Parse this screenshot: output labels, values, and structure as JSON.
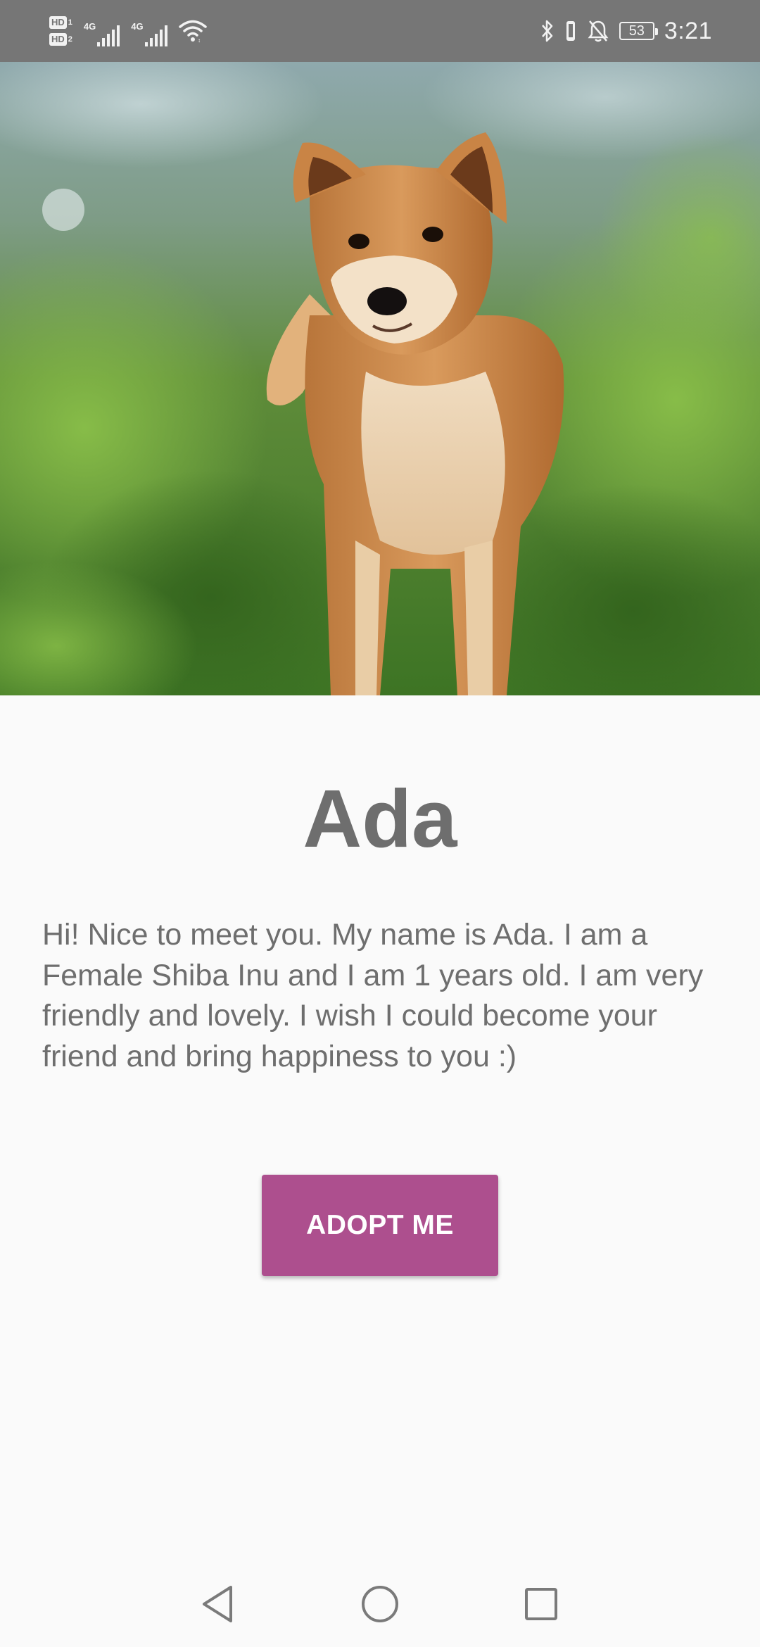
{
  "status_bar": {
    "sim1_label": "HD",
    "sim1_num": "1",
    "sim2_label": "HD",
    "sim2_num": "2",
    "network1": "4G",
    "network2": "4G",
    "battery_level": "53",
    "time": "3:21",
    "icons": [
      "bluetooth-icon",
      "vibrate-icon",
      "notifications-off-icon",
      "wifi-icon",
      "signal-icon"
    ]
  },
  "pet": {
    "photo_subject": "shiba-inu-photo",
    "name": "Ada",
    "description": "Hi! Nice to meet you. My name is Ada. I am a Female Shiba Inu and I am 1 years old. I am very friendly and lovely. I wish I could become your friend and bring happiness to you :)"
  },
  "actions": {
    "adopt_label": "ADOPT ME"
  },
  "nav_bar": {
    "icons": [
      "back-icon",
      "home-icon",
      "recents-icon"
    ]
  },
  "colors": {
    "accent": "#ad4f8e",
    "status_bar": "#767676",
    "text": "#6e6e6e",
    "background": "#fafafa"
  }
}
